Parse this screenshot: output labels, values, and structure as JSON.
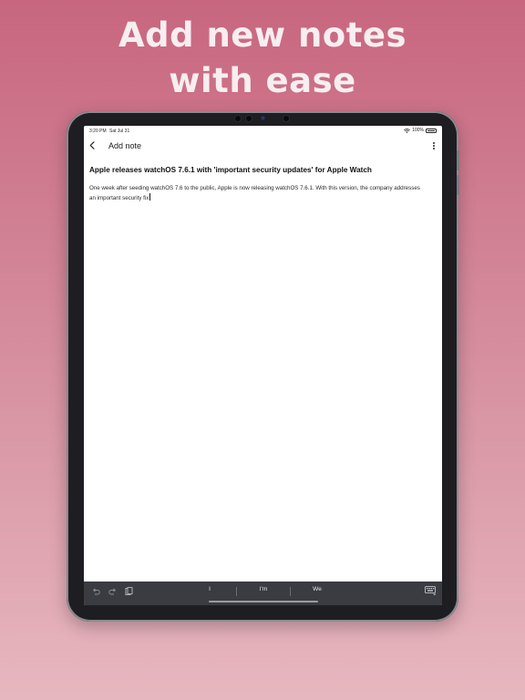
{
  "promo": {
    "line1": "Add new notes",
    "line2": "with ease"
  },
  "status_bar": {
    "time": "3:20 PM",
    "date": "Sat Jul 31",
    "battery": "100%"
  },
  "nav": {
    "title": "Add note",
    "back_icon": "chevron-left-icon",
    "more_icon": "more-vertical-icon"
  },
  "note": {
    "title": "Apple releases watchOS 7.6.1 with 'important security updates' for Apple Watch",
    "body": "One week after seeding watchOS 7.6 to the public, Apple is now releasing watchOS 7.6.1. With this version, the company addresses an important security fix"
  },
  "keyboard_bar": {
    "suggestions": [
      "I",
      "I'm",
      "We"
    ],
    "left_icons": [
      "undo-icon",
      "redo-icon",
      "paste-icon"
    ],
    "right_icon": "keyboard-dismiss-icon"
  },
  "colors": {
    "background_top": "#c8667f",
    "background_bottom": "#e7b7c0",
    "headline": "#f7eef0",
    "device_frame": "#1e1e22",
    "keyboard_bar": "#3a3c42"
  }
}
